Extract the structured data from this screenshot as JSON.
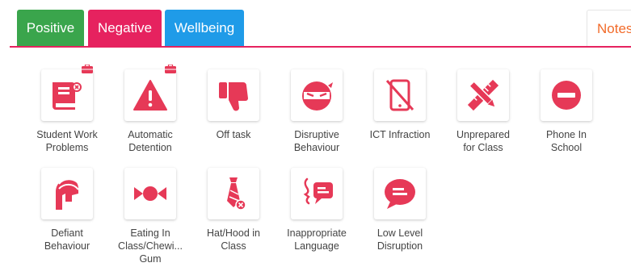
{
  "colors": {
    "positive": "#3aa54c",
    "negative": "#e6225f",
    "wellbeing": "#1f9be8",
    "notes": "#f26b2a",
    "icon": "#e63957"
  },
  "tabs": {
    "positive": "Positive",
    "negative": "Negative",
    "wellbeing": "Wellbeing",
    "notes": "Notes"
  },
  "behaviours": [
    {
      "label": "Student Work\nProblems",
      "icon": "book-icon",
      "has_case": true
    },
    {
      "label": "Automatic\nDetention",
      "icon": "warning-icon",
      "has_case": true
    },
    {
      "label": "Off task",
      "icon": "thumbs-down-icon",
      "has_case": false
    },
    {
      "label": "Disruptive\nBehaviour",
      "icon": "ninja-icon",
      "has_case": false
    },
    {
      "label": "ICT Infraction",
      "icon": "no-phone-icon",
      "has_case": false
    },
    {
      "label": "Unprepared\nfor Class",
      "icon": "pencil-ruler-icon",
      "has_case": false
    },
    {
      "label": "Phone In\nSchool",
      "icon": "minus-circle-icon",
      "has_case": false
    },
    {
      "label": "Defiant\nBehaviour",
      "icon": "spartan-helmet-icon",
      "has_case": false
    },
    {
      "label": "Eating In\nClass/Chewi...\nGum",
      "icon": "candy-icon",
      "has_case": false
    },
    {
      "label": "Hat/Hood in\nClass",
      "icon": "tie-icon",
      "has_case": false
    },
    {
      "label": "Inappropriate\nLanguage",
      "icon": "speech-icon",
      "has_case": false
    },
    {
      "label": "Low Level\nDisruption",
      "icon": "chat-bubble-icon",
      "has_case": false
    }
  ]
}
